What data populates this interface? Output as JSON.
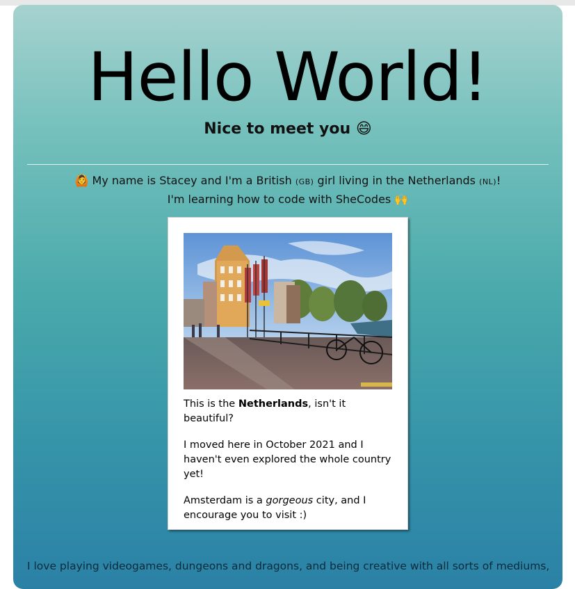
{
  "header": {
    "title": "Hello World!",
    "subtitle": "Nice to meet you 😄"
  },
  "intro": {
    "line1_emoji": "🙆",
    "line1_a": " My name is Stacey and I'm a British ",
    "line1_gb": "(GB)",
    "line1_b": " girl living in the Netherlands ",
    "line1_nl": "(NL)",
    "line1_c": "!",
    "line2": "I'm learning how to code with SheCodes 🙌"
  },
  "photo_card": {
    "image_icon": "amsterdam-canal-photo",
    "p1_before": "This is the ",
    "p1_bold": "Netherlands",
    "p1_after": ", isn't it beautiful?",
    "p2": "I moved here in October 2021 and I haven't even explored the whole country yet!",
    "p3_before": "Amsterdam is a ",
    "p3_italic": "gorgeous",
    "p3_after": " city, and I encourage you to visit :)"
  },
  "bottom": {
    "text": "I love playing videogames, dungeons and dragons, and being creative with all sorts of mediums,"
  },
  "colors": {
    "gradient_top": "#a6d2cf",
    "gradient_bottom": "#2a81a6"
  }
}
